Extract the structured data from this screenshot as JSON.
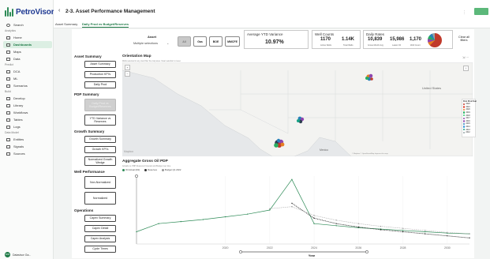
{
  "app": {
    "name": "PetroVisor"
  },
  "sidebar": {
    "search": "Search",
    "sections": [
      {
        "title": "Analytics",
        "items": [
          {
            "label": "Home",
            "icon": "home-icon",
            "active": false
          },
          {
            "label": "Dashboards",
            "icon": "dashboard-icon",
            "active": true
          },
          {
            "label": "Maps",
            "icon": "map-icon",
            "active": false
          },
          {
            "label": "Data",
            "icon": "data-icon",
            "active": false
          }
        ]
      },
      {
        "title": "Predict",
        "items": [
          {
            "label": "DCA",
            "icon": "dca-icon",
            "active": false
          },
          {
            "label": "ML",
            "icon": "ml-icon",
            "active": false
          },
          {
            "label": "Scenarios",
            "icon": "scenarios-icon",
            "active": false
          }
        ]
      },
      {
        "title": "Build",
        "items": [
          {
            "label": "Develop",
            "icon": "develop-icon",
            "active": false
          },
          {
            "label": "Library",
            "icon": "library-icon",
            "active": false
          },
          {
            "label": "Workflows",
            "icon": "workflows-icon",
            "active": false
          },
          {
            "label": "Tables",
            "icon": "tables-icon",
            "active": false
          },
          {
            "label": "Logs",
            "icon": "logs-icon",
            "active": false
          }
        ]
      },
      {
        "title": "Data Model",
        "items": [
          {
            "label": "Entities",
            "icon": "entities-icon",
            "active": false
          },
          {
            "label": "Signals",
            "icon": "signals-icon",
            "active": false
          },
          {
            "label": "Sources",
            "icon": "sources-icon",
            "active": false
          }
        ]
      }
    ],
    "user": {
      "initials": "DW",
      "name": "Datavisor Ga..."
    }
  },
  "header": {
    "back": "‹",
    "title": "2-3. Asset Performance Management",
    "button": ""
  },
  "tabs": [
    {
      "label": "Asset Summary",
      "active": false
    },
    {
      "label": "Daily Prod vs Budget/Reserves",
      "active": true
    }
  ],
  "filters": {
    "asset_label": "Asset",
    "asset_value": "Multiple selections",
    "chips": [
      {
        "label": "All",
        "selected": true
      },
      {
        "label": "Gas",
        "selected": false
      },
      {
        "label": "BOE",
        "selected": false
      },
      {
        "label": "MMCFE",
        "selected": false
      }
    ]
  },
  "kpis": {
    "ytd_variance": {
      "title": "Average YTD Variance",
      "value": "10.97%"
    },
    "well_counts": {
      "title": "Well Counts",
      "items": [
        {
          "value": "1170",
          "label": "Active Wells"
        },
        {
          "value": "1.14K",
          "label": "Total Wells"
        }
      ]
    },
    "daily_rates": {
      "title": "Daily Rates",
      "items": [
        {
          "value": "10,839",
          "label": "Gross Month Avg"
        },
        {
          "value": "15,986",
          "label": "Latest Oil"
        },
        {
          "value": "1,170",
          "label": "Well Count"
        }
      ]
    },
    "clear_filters": "Clear all filters"
  },
  "panel": {
    "sections": [
      {
        "title": "Asset Summary",
        "buttons": [
          {
            "label": "Asset Summary",
            "disabled": false
          },
          {
            "label": "Production KPI's",
            "disabled": false
          },
          {
            "label": "Daily Prod",
            "disabled": false
          }
        ]
      },
      {
        "title": "PDP Summary",
        "buttons": [
          {
            "label": "Daily Prod vs Budget/Reserves",
            "disabled": true
          },
          {
            "label": "YTD Variance vs Reserves",
            "disabled": false
          }
        ]
      },
      {
        "title": "Growth Summary",
        "buttons": [
          {
            "label": "Growth Summary",
            "disabled": false
          },
          {
            "label": "Growth KPI's",
            "disabled": false
          },
          {
            "label": "Normalized Growth Wedge",
            "disabled": false
          }
        ]
      },
      {
        "title": "Well Performance",
        "buttons": [
          {
            "label": "Non-Normalized",
            "disabled": false
          },
          {
            "label": "Normalized",
            "disabled": false
          }
        ]
      },
      {
        "title": "Operations",
        "buttons": [
          {
            "label": "Capex Summary",
            "disabled": false
          },
          {
            "label": "Capex Detail",
            "disabled": false
          },
          {
            "label": "Capex Analysis",
            "disabled": false
          },
          {
            "label": "Cycle Times",
            "disabled": false
          }
        ]
      }
    ]
  },
  "map": {
    "title": "Orientation Map",
    "subtitle": "Wells selected in any view filter the map area. Clear selection to reset.",
    "country_label": "United States",
    "country_label_2": "Mexico",
    "brand": "Mapbox",
    "credit": "© Mapbox © OpenStreetMap Improve this map",
    "legend_title": "First Prod Year",
    "legend": [
      {
        "label": "2022",
        "color": "#c0392b"
      },
      {
        "label": "2021",
        "color": "#e74c3c"
      },
      {
        "label": "2020",
        "color": "#e67e22"
      },
      {
        "label": "2019",
        "color": "#27ae60"
      },
      {
        "label": "2018",
        "color": "#2ecc71"
      },
      {
        "label": "2017",
        "color": "#8e44ad"
      },
      {
        "label": "2016",
        "color": "#9b59b6"
      },
      {
        "label": "2015",
        "color": "#2980b9"
      },
      {
        "label": "2014",
        "color": "#3498db"
      },
      {
        "label": "2013",
        "color": "#16a085"
      },
      {
        "label": "2012",
        "color": "#95a5a6"
      }
    ]
  },
  "chart": {
    "title": "Aggregate Gross Oil PDP",
    "subtitle": "Actuals vs. PDP Reserves Forecast and Budget over time",
    "legend": [
      {
        "label": "Oil Actual (bbl)",
        "color": "#2e8b57"
      },
      {
        "label": "Reserves",
        "color": "#333333"
      },
      {
        "label": "Budget Q1 2022",
        "color": "#999999"
      }
    ],
    "x_title": "Year"
  },
  "chart_data": {
    "type": "line",
    "x": [
      2016,
      2017,
      2018,
      2019,
      2020,
      2021,
      2022,
      2023,
      2024,
      2025,
      2026,
      2027,
      2028,
      2029,
      2030,
      2031
    ],
    "x_tick_labels": [
      "2020",
      "2022",
      "2024",
      "2026",
      "2028",
      "2030"
    ],
    "x_tick_values": [
      2020,
      2022,
      2024,
      2026,
      2028,
      2030
    ],
    "ylim": [
      0,
      100
    ],
    "series": [
      {
        "name": "Oil Actual (bbl)",
        "values": [
          18,
          30,
          33,
          36,
          40,
          44,
          50,
          95,
          30,
          27,
          24,
          22,
          20,
          18,
          16,
          15
        ]
      },
      {
        "name": "Reserves",
        "values": [
          null,
          null,
          null,
          null,
          null,
          null,
          null,
          60,
          38,
          30,
          25,
          21,
          18,
          15,
          12,
          9
        ]
      },
      {
        "name": "Budget Q1 2022",
        "values": [
          null,
          null,
          null,
          null,
          null,
          null,
          52,
          55,
          42,
          35,
          30,
          26,
          23,
          20,
          17,
          15
        ]
      }
    ]
  }
}
